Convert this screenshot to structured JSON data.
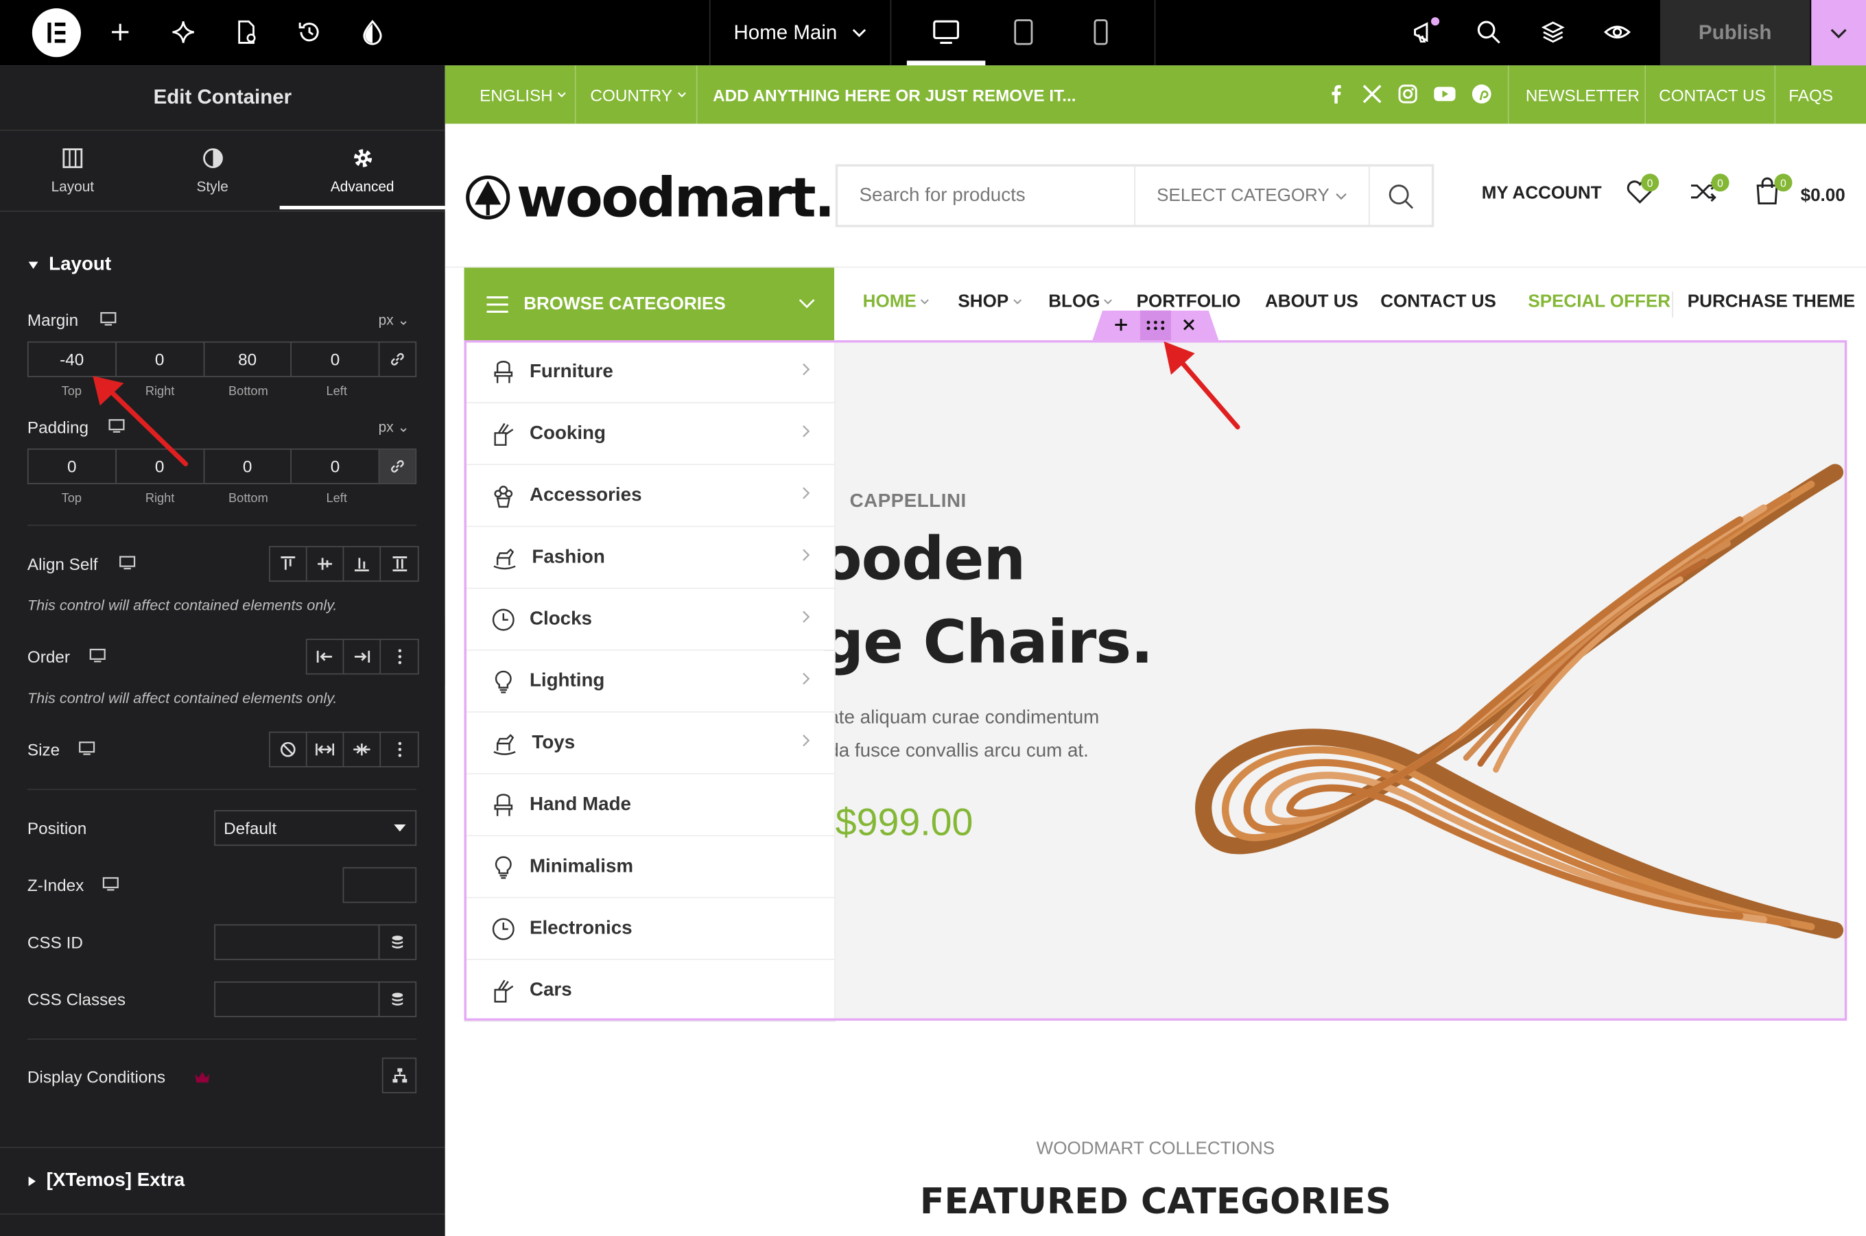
{
  "topbar": {
    "page_name": "Home Main",
    "publish_label": "Publish",
    "icons": [
      "elementor-logo-icon",
      "add-icon",
      "ai-sparkle-icon",
      "page-settings-icon",
      "history-icon",
      "theme-style-icon",
      "desktop-icon",
      "tablet-icon",
      "mobile-icon",
      "notifications-icon",
      "search-icon",
      "structure-icon",
      "preview-icon",
      "chevron-down-icon"
    ],
    "accent_color": "#e6a9f5"
  },
  "panel": {
    "title": "Edit Container",
    "tabs": [
      {
        "label": "Layout",
        "icon": "layout-icon"
      },
      {
        "label": "Style",
        "icon": "style-icon"
      },
      {
        "label": "Advanced",
        "icon": "gear-icon",
        "active": true
      }
    ],
    "section_layout": "Layout",
    "margin": {
      "label": "Margin",
      "unit": "px",
      "values": [
        "-40",
        "0",
        "80",
        "0"
      ]
    },
    "padding": {
      "label": "Padding",
      "unit": "px",
      "values": [
        "0",
        "0",
        "0",
        "0"
      ]
    },
    "sides": [
      "Top",
      "Right",
      "Bottom",
      "Left"
    ],
    "align_self": "Align Self",
    "note": "This control will affect contained elements only.",
    "order": "Order",
    "size": "Size",
    "position": {
      "label": "Position",
      "value": "Default"
    },
    "z_index": "Z-Index",
    "css_id": "CSS ID",
    "css_classes": "CSS Classes",
    "display_conditions": "Display Conditions",
    "section_extra": "[XTemos] Extra"
  },
  "site": {
    "topbar": {
      "language": "ENGLISH",
      "country": "COUNTRY",
      "promo": "ADD ANYTHING HERE OR JUST REMOVE IT...",
      "socials": [
        "facebook-icon",
        "x-icon",
        "instagram-icon",
        "youtube-icon",
        "pinterest-icon"
      ],
      "links": [
        "NEWSLETTER",
        "CONTACT US",
        "FAQS"
      ]
    },
    "brand": "woodmart.",
    "search_placeholder": "Search for products",
    "select_category": "SELECT CATEGORY",
    "my_account": "MY ACCOUNT",
    "wishlist_count": "0",
    "compare_count": "0",
    "cart_count": "0",
    "cart_total": "$0.00",
    "browse": "BROWSE CATEGORIES",
    "nav": [
      {
        "label": "HOME",
        "dropdown": true,
        "active": true
      },
      {
        "label": "SHOP",
        "dropdown": true
      },
      {
        "label": "BLOG",
        "dropdown": true
      },
      {
        "label": "PORTFOLIO",
        "dropdown": false
      },
      {
        "label": "ABOUT US",
        "dropdown": false
      },
      {
        "label": "CONTACT US",
        "dropdown": false
      },
      {
        "label": "SPECIAL OFFER",
        "dropdown": false,
        "highlight": true
      },
      {
        "label": "PURCHASE THEME",
        "dropdown": false
      }
    ],
    "categories": [
      {
        "label": "Furniture",
        "arrow": true
      },
      {
        "label": "Cooking",
        "arrow": true
      },
      {
        "label": "Accessories",
        "arrow": true
      },
      {
        "label": "Fashion",
        "arrow": true
      },
      {
        "label": "Clocks",
        "arrow": true
      },
      {
        "label": "Lighting",
        "arrow": true
      },
      {
        "label": "Toys",
        "arrow": true
      },
      {
        "label": "Hand Made",
        "arrow": false
      },
      {
        "label": "Minimalism",
        "arrow": false
      },
      {
        "label": "Electronics",
        "arrow": false
      },
      {
        "label": "Cars",
        "arrow": false
      }
    ],
    "slide": {
      "brand": "CAPPELLINI",
      "title_line1": "ooden",
      "title_line2": "ge Chairs.",
      "desc_line1": "ate aliquam curae condimentum",
      "desc_line2": "da fusce convallis arcu cum at.",
      "price": "$999.00",
      "active_dot": 3
    },
    "collections_sub": "WOODMART COLLECTIONS",
    "collections_title": "FEATURED CATEGORIES",
    "green": "#83b735"
  }
}
